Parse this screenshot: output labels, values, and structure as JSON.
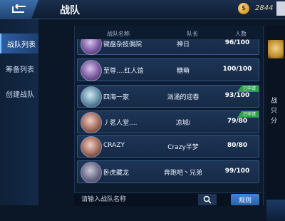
{
  "header": {
    "title": "战队",
    "coin_symbol": "$",
    "coin_count": "2844"
  },
  "sidebar": {
    "items": [
      {
        "label": "战队列表",
        "active": true
      },
      {
        "label": "筹备列表",
        "active": false
      },
      {
        "label": "创建战队",
        "active": false
      }
    ]
  },
  "table": {
    "columns": [
      "战队名称",
      "队长",
      "人数"
    ],
    "rows": [
      {
        "name": "键盘杂技偶院",
        "leader": "神日",
        "count": "96/100",
        "badge": ""
      },
      {
        "name": "至尊....红人馆",
        "leader": "糖萌",
        "count": "100/100",
        "badge": ""
      },
      {
        "name": "四海一家",
        "leader": "汹涌的迎春",
        "count": "93/100",
        "badge": "已申请"
      },
      {
        "name": "丿茗人堂....",
        "leader": "凉城i",
        "count": "79/80",
        "badge": "已申请"
      },
      {
        "name": "CRAZY",
        "leader": "Crazy半梦",
        "count": "80/80",
        "badge": ""
      },
      {
        "name": "卧虎藏龙",
        "leader": "奔跑吧丶兄弟",
        "count": "99/100",
        "badge": ""
      }
    ]
  },
  "search": {
    "placeholder": "请输入战队名称",
    "submit_label": "规则"
  },
  "right_panel": {
    "lines": [
      "战",
      "只",
      "分"
    ]
  },
  "colors": {
    "accent": "#2d5da3",
    "badge": "#2fa24a",
    "coin": "#d49a1f"
  }
}
